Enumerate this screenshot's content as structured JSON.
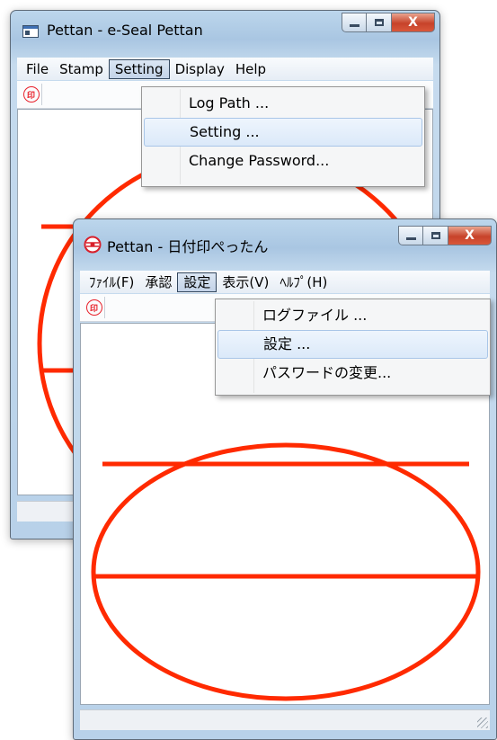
{
  "back_window": {
    "title": "Pettan - e-Seal Pettan",
    "menu": [
      "File",
      "Stamp",
      "Setting",
      "Display",
      "Help"
    ],
    "open_menu_index": 2,
    "dropdown": [
      "Log Path ...",
      "Setting ...",
      "Change Password..."
    ],
    "highlighted_item_index": 1,
    "close_glyph": "X"
  },
  "front_window": {
    "title": "Pettan - 日付印ぺったん",
    "menu": [
      "ﾌｧｲﾙ(F)",
      "承認",
      "設定",
      "表示(V)",
      "ﾍﾙﾌﾟ(H)"
    ],
    "open_menu_index": 2,
    "dropdown": [
      "ログファイル ...",
      "設定 ...",
      "パスワードの変更..."
    ],
    "highlighted_item_index": 1,
    "close_glyph": "X"
  },
  "stamp_icon_text": "印",
  "colors": {
    "seal_red": "#ff2a00",
    "title_glass": "#a9c6e2",
    "menu_highlight": "#dbe9f9",
    "close_button": "#c7432a"
  },
  "icons": [
    "app-window-icon",
    "seal-app-icon",
    "stamp-icon",
    "minimize-icon",
    "maximize-icon",
    "close-icon",
    "resize-grip-icon"
  ]
}
